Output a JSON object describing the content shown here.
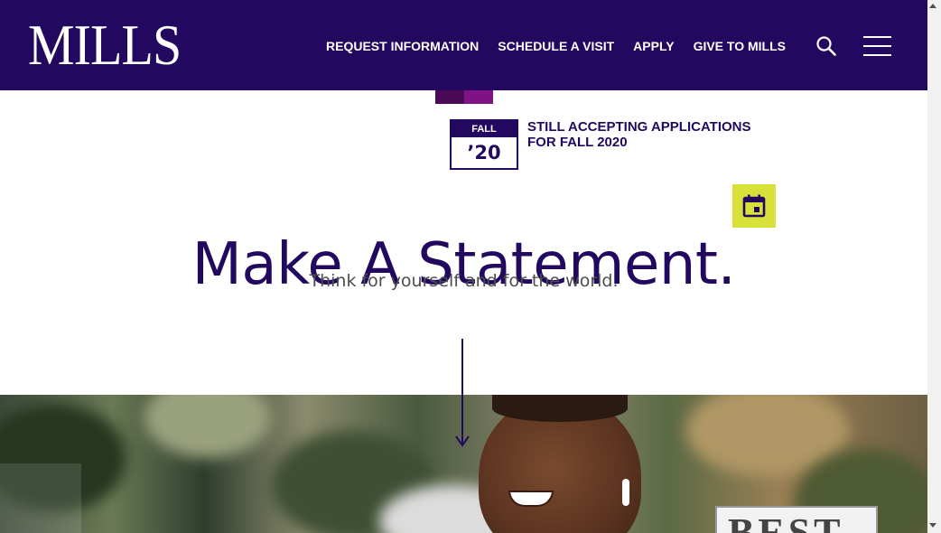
{
  "header": {
    "logo": "MILLS",
    "nav": [
      {
        "label": "REQUEST INFORMATION"
      },
      {
        "label": "SCHEDULE A VISIT"
      },
      {
        "label": "APPLY"
      },
      {
        "label": "GIVE TO MILLS"
      }
    ],
    "search_icon": "search-icon",
    "menu_icon": "hamburger-menu-icon"
  },
  "banner": {
    "badge_top": "FALL",
    "badge_year": "’20",
    "announcement": "STILL ACCEPTING APPLICATIONS FOR FALL 2020"
  },
  "hero": {
    "headline": "Make A Statement.",
    "subheadline": "Think for yourself and for the world.",
    "calendar_icon": "calendar-icon",
    "scroll_icon": "arrow-down-icon",
    "best_badge_text": "BEST"
  },
  "colors": {
    "brand_purple": "#22095f",
    "accent_yellow": "#d8e03a",
    "deco_plum": "#4a0a56",
    "deco_magenta": "#7e1286"
  }
}
